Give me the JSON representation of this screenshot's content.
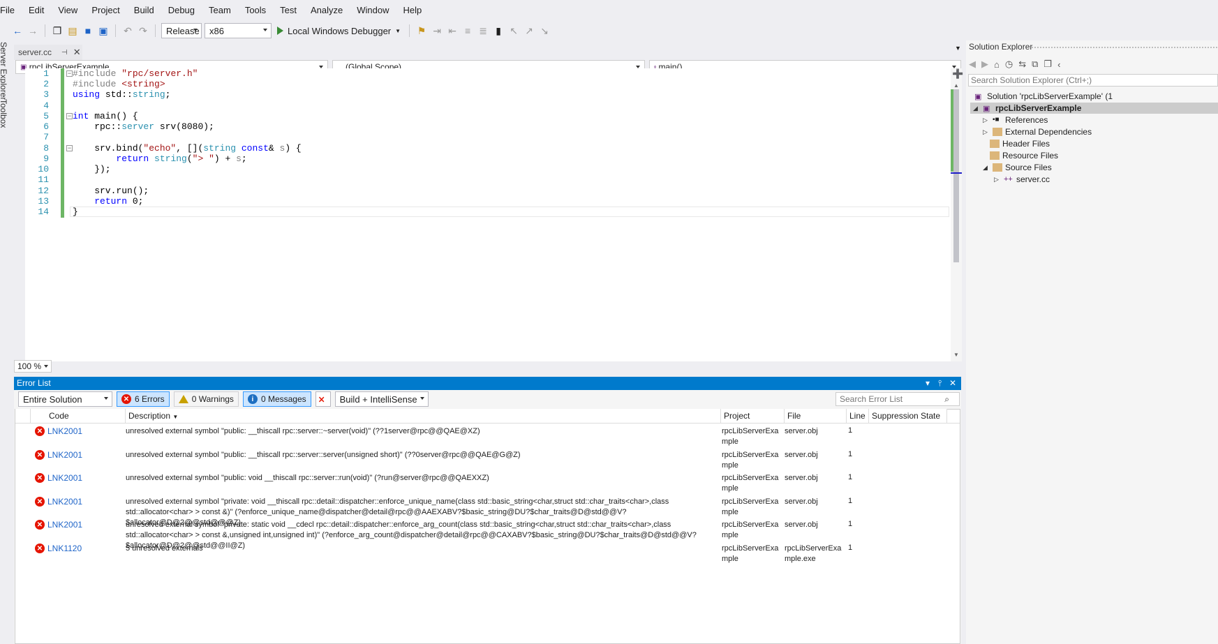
{
  "menu": [
    "File",
    "Edit",
    "View",
    "Project",
    "Build",
    "Debug",
    "Team",
    "Tools",
    "Test",
    "Analyze",
    "Window",
    "Help"
  ],
  "toolbar": {
    "config": "Release",
    "platform": "x86",
    "debugger": "Local Windows Debugger"
  },
  "side_tabs": [
    "Server Explorer",
    "Toolbox"
  ],
  "editor": {
    "tab_name": "server.cc",
    "nav_project": "rpcLibServerExample",
    "nav_scope": "(Global Scope)",
    "nav_member": "main()",
    "zoom": "100 %",
    "line_numbers": [
      "1",
      "2",
      "3",
      "4",
      "5",
      "6",
      "7",
      "8",
      "9",
      "10",
      "11",
      "12",
      "13",
      "14"
    ]
  },
  "error_list": {
    "title": "Error List",
    "scope": "Entire Solution",
    "errors_label": "6 Errors",
    "warnings_label": "0 Warnings",
    "messages_label": "0 Messages",
    "build_filter": "Build + IntelliSense",
    "search_placeholder": "Search Error List",
    "columns": {
      "code": "Code",
      "description": "Description",
      "project": "Project",
      "file": "File",
      "line": "Line",
      "suppression": "Suppression State"
    },
    "rows": [
      {
        "code": "LNK2001",
        "desc": "unresolved external symbol \"public: __thiscall rpc::server::~server(void)\" (??1server@rpc@@QAE@XZ)",
        "project": "rpcLibServerExample",
        "file": "server.obj",
        "line": "1"
      },
      {
        "code": "LNK2001",
        "desc": "unresolved external symbol \"public: __thiscall rpc::server::server(unsigned short)\" (??0server@rpc@@QAE@G@Z)",
        "project": "rpcLibServerExample",
        "file": "server.obj",
        "line": "1"
      },
      {
        "code": "LNK2001",
        "desc": "unresolved external symbol \"public: void __thiscall rpc::server::run(void)\" (?run@server@rpc@@QAEXXZ)",
        "project": "rpcLibServerExample",
        "file": "server.obj",
        "line": "1"
      },
      {
        "code": "LNK2001",
        "desc": "unresolved external symbol \"private: void __thiscall rpc::detail::dispatcher::enforce_unique_name(class std::basic_string<char,struct std::char_traits<char>,class std::allocator<char> > const &)\" (?enforce_unique_name@dispatcher@detail@rpc@@AAEXABV?$basic_string@DU?$char_traits@D@std@@V?$allocator@D@2@@std@@@Z)",
        "project": "rpcLibServerExample",
        "file": "server.obj",
        "line": "1"
      },
      {
        "code": "LNK2001",
        "desc": "unresolved external symbol \"private: static void __cdecl rpc::detail::dispatcher::enforce_arg_count(class std::basic_string<char,struct std::char_traits<char>,class std::allocator<char> > const &,unsigned int,unsigned int)\" (?enforce_arg_count@dispatcher@detail@rpc@@CAXABV?$basic_string@DU?$char_traits@D@std@@V?$allocator@D@2@@std@@II@Z)",
        "project": "rpcLibServerExample",
        "file": "server.obj",
        "line": "1"
      },
      {
        "code": "LNK1120",
        "desc": "5 unresolved externals",
        "project": "rpcLibServerExample",
        "file": "rpcLibServerExample.exe",
        "line": "1"
      }
    ]
  },
  "solution_explorer": {
    "title": "Solution Explorer",
    "search_placeholder": "Search Solution Explorer (Ctrl+;)",
    "solution": "Solution 'rpcLibServerExample' (1",
    "project": "rpcLibServerExample",
    "nodes": [
      "References",
      "External Dependencies",
      "Header Files",
      "Resource Files",
      "Source Files",
      "server.cc"
    ]
  }
}
